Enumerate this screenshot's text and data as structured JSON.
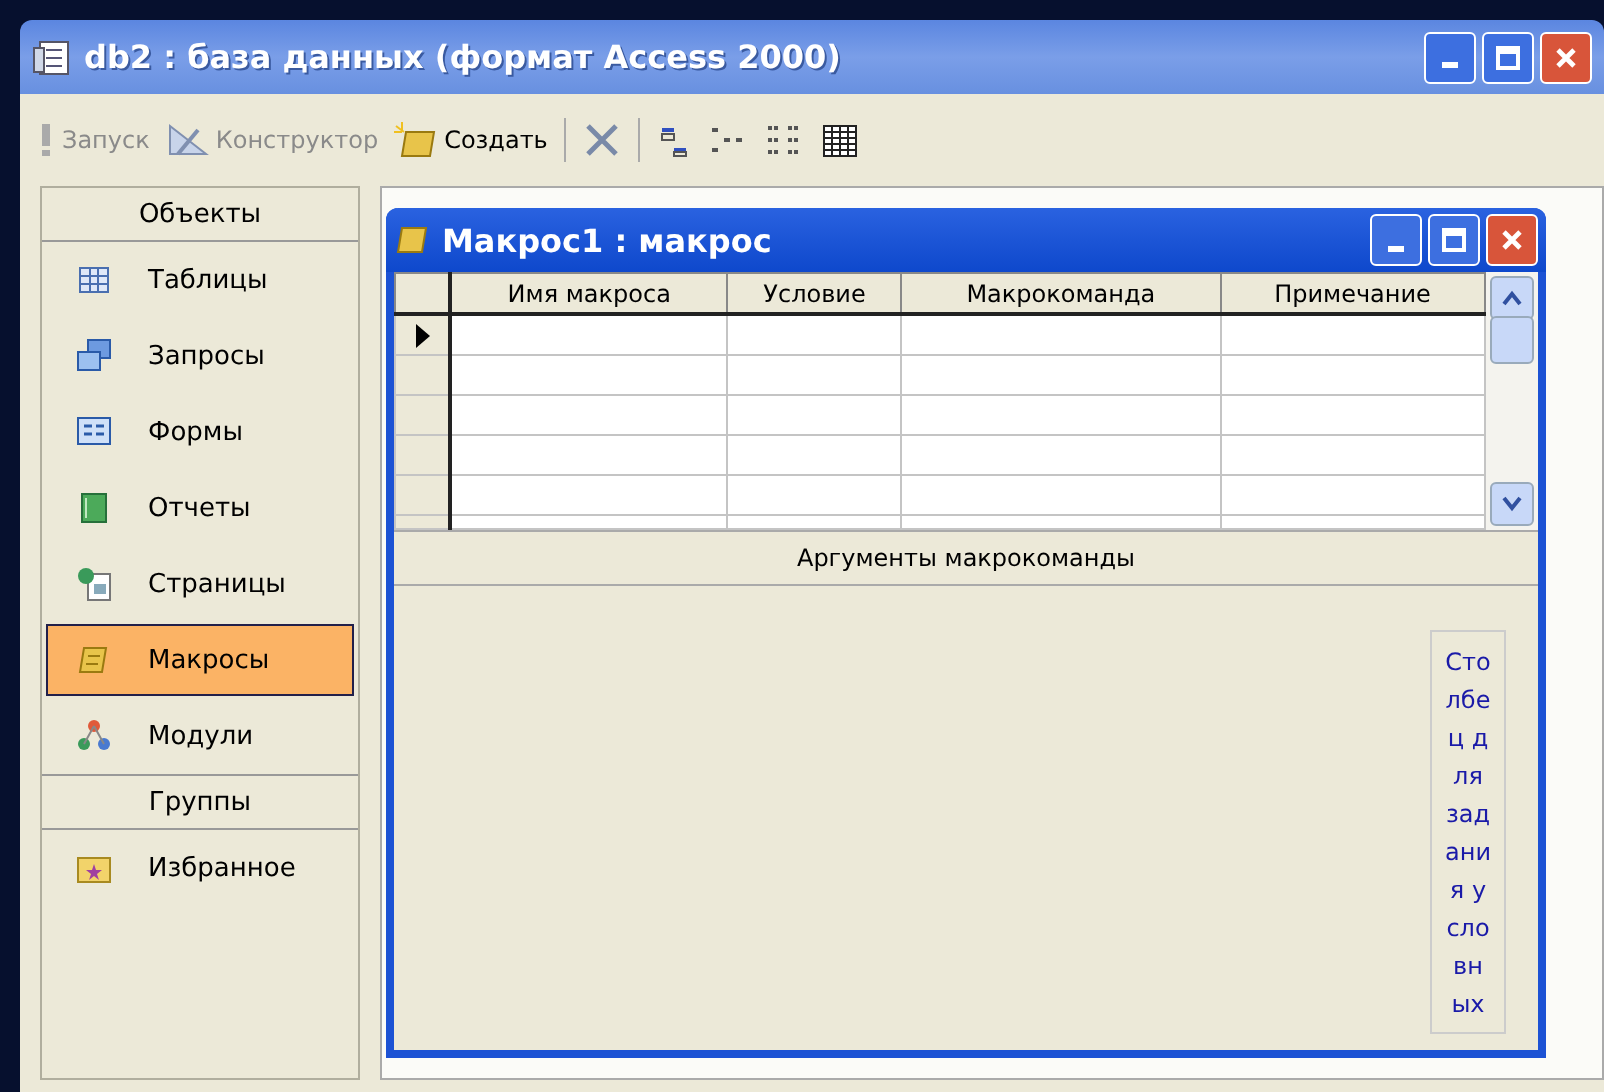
{
  "window": {
    "title": "db2 : база данных (формат Access 2000)"
  },
  "toolbar": {
    "buttons": [
      {
        "label": "Запуск",
        "disabled": true
      },
      {
        "label": "Конструктор",
        "disabled": true
      },
      {
        "label": "Создать",
        "disabled": false
      }
    ]
  },
  "sidebar": {
    "sections": [
      {
        "header": "Объекты",
        "items": [
          {
            "label": "Таблицы",
            "selected": false
          },
          {
            "label": "Запросы",
            "selected": false
          },
          {
            "label": "Формы",
            "selected": false
          },
          {
            "label": "Отчеты",
            "selected": false
          },
          {
            "label": "Страницы",
            "selected": false
          },
          {
            "label": "Макросы",
            "selected": true
          },
          {
            "label": "Модули",
            "selected": false
          }
        ]
      },
      {
        "header": "Группы",
        "items": [
          {
            "label": "Избранное",
            "selected": false
          }
        ]
      }
    ]
  },
  "macro_window": {
    "title": "Макрос1 : макрос",
    "columns": [
      "Имя макроса",
      "Условие",
      "Макрокоманда",
      "Примечание"
    ],
    "rows": [
      {
        "current": true
      },
      {
        "current": false
      },
      {
        "current": false
      },
      {
        "current": false
      },
      {
        "current": false
      },
      {
        "current": false
      }
    ],
    "arguments_label": "Аргументы макрокоманды",
    "note": "Столбец для задания условных"
  }
}
